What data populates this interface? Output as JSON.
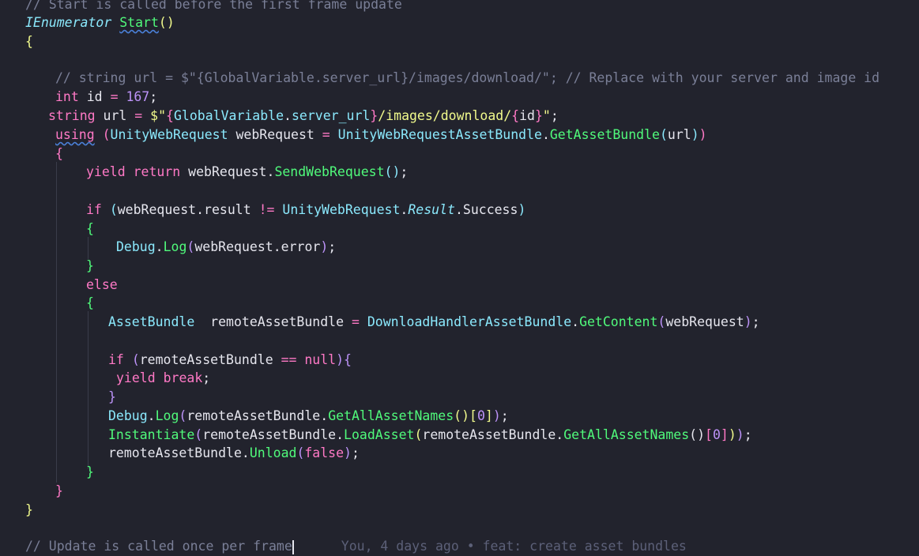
{
  "editor": {
    "language": "csharp",
    "theme_colors": {
      "background": "#22232d",
      "keyword": "#ff79c6",
      "type": "#8be9fd",
      "function": "#50fa7b",
      "string": "#f1fa8c",
      "number": "#bd93f9",
      "comment": "#7a7f97",
      "text": "#e6e6ee"
    },
    "lines": [
      {
        "tokens": [
          {
            "cls": "c",
            "text": "// Start is called before the first frame update"
          }
        ]
      },
      {
        "tokens": [
          {
            "cls": "ti",
            "text": "IEnumerator"
          },
          {
            "cls": "p",
            "text": " "
          },
          {
            "cls": "f squiggle",
            "text": "Start"
          },
          {
            "cls": "b1",
            "text": "()"
          }
        ]
      },
      {
        "tokens": [
          {
            "cls": "b1",
            "text": "{"
          }
        ]
      },
      {
        "tokens": []
      },
      {
        "tokens": [
          {
            "cls": "c",
            "text": "// string url = $\"{GlobalVariable.server_url}/images/download/\"; // Replace with your server and image id"
          }
        ]
      },
      {
        "tokens": [
          {
            "cls": "k",
            "text": "int"
          },
          {
            "cls": "v",
            "text": " id "
          },
          {
            "cls": "k",
            "text": "="
          },
          {
            "cls": "v",
            "text": " "
          },
          {
            "cls": "n",
            "text": "167"
          },
          {
            "cls": "p",
            "text": ";"
          }
        ]
      },
      {
        "tokens": [
          {
            "cls": "k",
            "text": "string"
          },
          {
            "cls": "v",
            "text": " url "
          },
          {
            "cls": "k",
            "text": "="
          },
          {
            "cls": "v",
            "text": " "
          },
          {
            "cls": "s",
            "text": "$\""
          },
          {
            "cls": "b2",
            "text": "{"
          },
          {
            "cls": "t",
            "text": "GlobalVariable"
          },
          {
            "cls": "p",
            "text": "."
          },
          {
            "cls": "t",
            "text": "server_url"
          },
          {
            "cls": "b2",
            "text": "}"
          },
          {
            "cls": "s",
            "text": "/images/download/"
          },
          {
            "cls": "b2",
            "text": "{"
          },
          {
            "cls": "v",
            "text": "id"
          },
          {
            "cls": "b2",
            "text": "}"
          },
          {
            "cls": "s",
            "text": "\""
          },
          {
            "cls": "p",
            "text": ";"
          }
        ]
      },
      {
        "tokens": [
          {
            "cls": "k squiggle",
            "text": "using"
          },
          {
            "cls": "v",
            "text": " "
          },
          {
            "cls": "b2",
            "text": "("
          },
          {
            "cls": "t",
            "text": "UnityWebRequest"
          },
          {
            "cls": "v",
            "text": " webRequest "
          },
          {
            "cls": "k",
            "text": "="
          },
          {
            "cls": "v",
            "text": " "
          },
          {
            "cls": "t",
            "text": "UnityWebRequestAssetBundle"
          },
          {
            "cls": "p",
            "text": "."
          },
          {
            "cls": "f",
            "text": "GetAssetBundle"
          },
          {
            "cls": "b3",
            "text": "("
          },
          {
            "cls": "v",
            "text": "url"
          },
          {
            "cls": "b3",
            "text": ")"
          },
          {
            "cls": "b2",
            "text": ")"
          }
        ]
      },
      {
        "tokens": [
          {
            "cls": "b2",
            "text": "{"
          }
        ]
      },
      {
        "tokens": [
          {
            "cls": "k",
            "text": "yield return"
          },
          {
            "cls": "v",
            "text": " webRequest"
          },
          {
            "cls": "p",
            "text": "."
          },
          {
            "cls": "f",
            "text": "SendWebRequest"
          },
          {
            "cls": "b3",
            "text": "()"
          },
          {
            "cls": "p",
            "text": ";"
          }
        ]
      },
      {
        "tokens": []
      },
      {
        "tokens": [
          {
            "cls": "k",
            "text": "if"
          },
          {
            "cls": "v",
            "text": " "
          },
          {
            "cls": "b3",
            "text": "("
          },
          {
            "cls": "v",
            "text": "webRequest"
          },
          {
            "cls": "p",
            "text": "."
          },
          {
            "cls": "v",
            "text": "result "
          },
          {
            "cls": "k",
            "text": "!="
          },
          {
            "cls": "v",
            "text": " "
          },
          {
            "cls": "t",
            "text": "UnityWebRequest"
          },
          {
            "cls": "p",
            "text": "."
          },
          {
            "cls": "ti",
            "text": "Result"
          },
          {
            "cls": "p",
            "text": "."
          },
          {
            "cls": "v",
            "text": "Success"
          },
          {
            "cls": "b3",
            "text": ")"
          }
        ]
      },
      {
        "tokens": [
          {
            "cls": "b4",
            "text": "{"
          }
        ]
      },
      {
        "tokens": [
          {
            "cls": "t",
            "text": "Debug"
          },
          {
            "cls": "p",
            "text": "."
          },
          {
            "cls": "f",
            "text": "Log"
          },
          {
            "cls": "b5",
            "text": "("
          },
          {
            "cls": "v",
            "text": "webRequest"
          },
          {
            "cls": "p",
            "text": "."
          },
          {
            "cls": "v",
            "text": "error"
          },
          {
            "cls": "b5",
            "text": ")"
          },
          {
            "cls": "p",
            "text": ";"
          }
        ]
      },
      {
        "tokens": [
          {
            "cls": "b4",
            "text": "}"
          }
        ]
      },
      {
        "tokens": [
          {
            "cls": "k",
            "text": "else"
          }
        ]
      },
      {
        "tokens": [
          {
            "cls": "b4",
            "text": "{"
          }
        ]
      },
      {
        "tokens": [
          {
            "cls": "t",
            "text": "AssetBundle"
          },
          {
            "cls": "v",
            "text": "  remoteAssetBundle "
          },
          {
            "cls": "k",
            "text": "="
          },
          {
            "cls": "v",
            "text": " "
          },
          {
            "cls": "t",
            "text": "DownloadHandlerAssetBundle"
          },
          {
            "cls": "p",
            "text": "."
          },
          {
            "cls": "f",
            "text": "GetContent"
          },
          {
            "cls": "b5",
            "text": "("
          },
          {
            "cls": "v",
            "text": "webRequest"
          },
          {
            "cls": "b5",
            "text": ")"
          },
          {
            "cls": "p",
            "text": ";"
          }
        ]
      },
      {
        "tokens": []
      },
      {
        "tokens": [
          {
            "cls": "k",
            "text": "if"
          },
          {
            "cls": "v",
            "text": " "
          },
          {
            "cls": "b5",
            "text": "("
          },
          {
            "cls": "v",
            "text": "remoteAssetBundle "
          },
          {
            "cls": "k",
            "text": "=="
          },
          {
            "cls": "v",
            "text": " "
          },
          {
            "cls": "k",
            "text": "null"
          },
          {
            "cls": "b5",
            "text": "){"
          }
        ]
      },
      {
        "tokens": [
          {
            "cls": "k",
            "text": "yield break"
          },
          {
            "cls": "p",
            "text": ";"
          }
        ]
      },
      {
        "tokens": [
          {
            "cls": "b5",
            "text": "}"
          }
        ]
      },
      {
        "tokens": [
          {
            "cls": "t",
            "text": "Debug"
          },
          {
            "cls": "p",
            "text": "."
          },
          {
            "cls": "f",
            "text": "Log"
          },
          {
            "cls": "b5",
            "text": "("
          },
          {
            "cls": "v",
            "text": "remoteAssetBundle"
          },
          {
            "cls": "p",
            "text": "."
          },
          {
            "cls": "f",
            "text": "GetAllAssetNames"
          },
          {
            "cls": "b1",
            "text": "()"
          },
          {
            "cls": "b1",
            "text": "["
          },
          {
            "cls": "n",
            "text": "0"
          },
          {
            "cls": "b1",
            "text": "]"
          },
          {
            "cls": "b5",
            "text": ")"
          },
          {
            "cls": "p",
            "text": ";"
          }
        ]
      },
      {
        "tokens": [
          {
            "cls": "f",
            "text": "Instantiate"
          },
          {
            "cls": "b5",
            "text": "("
          },
          {
            "cls": "v",
            "text": "remoteAssetBundle"
          },
          {
            "cls": "p",
            "text": "."
          },
          {
            "cls": "f",
            "text": "LoadAsset"
          },
          {
            "cls": "b1",
            "text": "("
          },
          {
            "cls": "v",
            "text": "remoteAssetBundle"
          },
          {
            "cls": "p",
            "text": "."
          },
          {
            "cls": "f",
            "text": "GetAllAssetNames"
          },
          {
            "cls": "v",
            "text": "()"
          },
          {
            "cls": "b2",
            "text": "["
          },
          {
            "cls": "n",
            "text": "0"
          },
          {
            "cls": "b2",
            "text": "]"
          },
          {
            "cls": "b1",
            "text": ")"
          },
          {
            "cls": "b5",
            "text": ")"
          },
          {
            "cls": "p",
            "text": ";"
          }
        ]
      },
      {
        "tokens": [
          {
            "cls": "v",
            "text": "remoteAssetBundle"
          },
          {
            "cls": "p",
            "text": "."
          },
          {
            "cls": "f",
            "text": "Unload"
          },
          {
            "cls": "b5",
            "text": "("
          },
          {
            "cls": "k",
            "text": "false"
          },
          {
            "cls": "b5",
            "text": ")"
          },
          {
            "cls": "p",
            "text": ";"
          }
        ]
      },
      {
        "tokens": [
          {
            "cls": "b4",
            "text": "}"
          }
        ]
      },
      {
        "tokens": [
          {
            "cls": "b2",
            "text": "}"
          }
        ]
      },
      {
        "tokens": [
          {
            "cls": "b1",
            "text": "}"
          }
        ]
      },
      {
        "tokens": []
      },
      {
        "tokens": [
          {
            "cls": "c",
            "text": "// Update is called once per frame"
          }
        ],
        "cursor": true,
        "ghost": "You, 4 days ago • feat: create asset bundles"
      }
    ]
  }
}
